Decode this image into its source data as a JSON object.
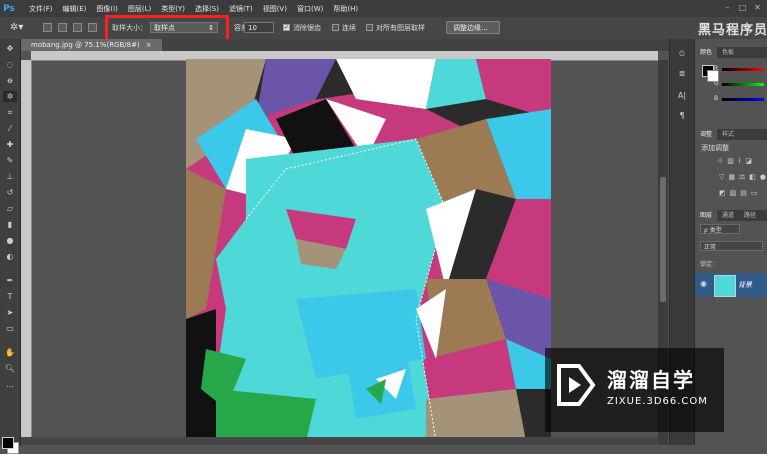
{
  "app": {
    "logo": "Ps"
  },
  "menu": [
    "文件(F)",
    "编辑(E)",
    "图像(I)",
    "图层(L)",
    "类型(Y)",
    "选择(S)",
    "滤镜(T)",
    "视图(V)",
    "窗口(W)",
    "帮助(H)"
  ],
  "options": {
    "sample_size_label": "取样大小：",
    "sample_size_value": "取样点",
    "tolerance_label": "容差：",
    "tolerance_value": "10",
    "antialias_label": "消除锯齿",
    "contiguous_label": "连续",
    "all_layers_label": "对所有图层取样",
    "refine_edge_label": "调整边缘..."
  },
  "brand": "黑马程序员",
  "document": {
    "tab": "mobang.jpg @ 75.1%(RGB/8#)"
  },
  "panels": {
    "color_tabs": [
      "颜色",
      "色板"
    ],
    "rgb": [
      "R",
      "G",
      "B"
    ],
    "adjust_tabs": [
      "调整",
      "样式"
    ],
    "adjust_title": "添加调整",
    "layer_tabs": [
      "图层",
      "通道",
      "路径"
    ],
    "kind": "ρ 类型",
    "blend_mode": "正常",
    "lock_label": "锁定："
  },
  "layer": {
    "name": "背景"
  },
  "watermark": {
    "title": "溜溜自学",
    "url": "ZIXUE.3D66.COM"
  },
  "colors": {
    "accent_red": "#ff1f1f",
    "ps_blue": "#3aa7ff"
  }
}
